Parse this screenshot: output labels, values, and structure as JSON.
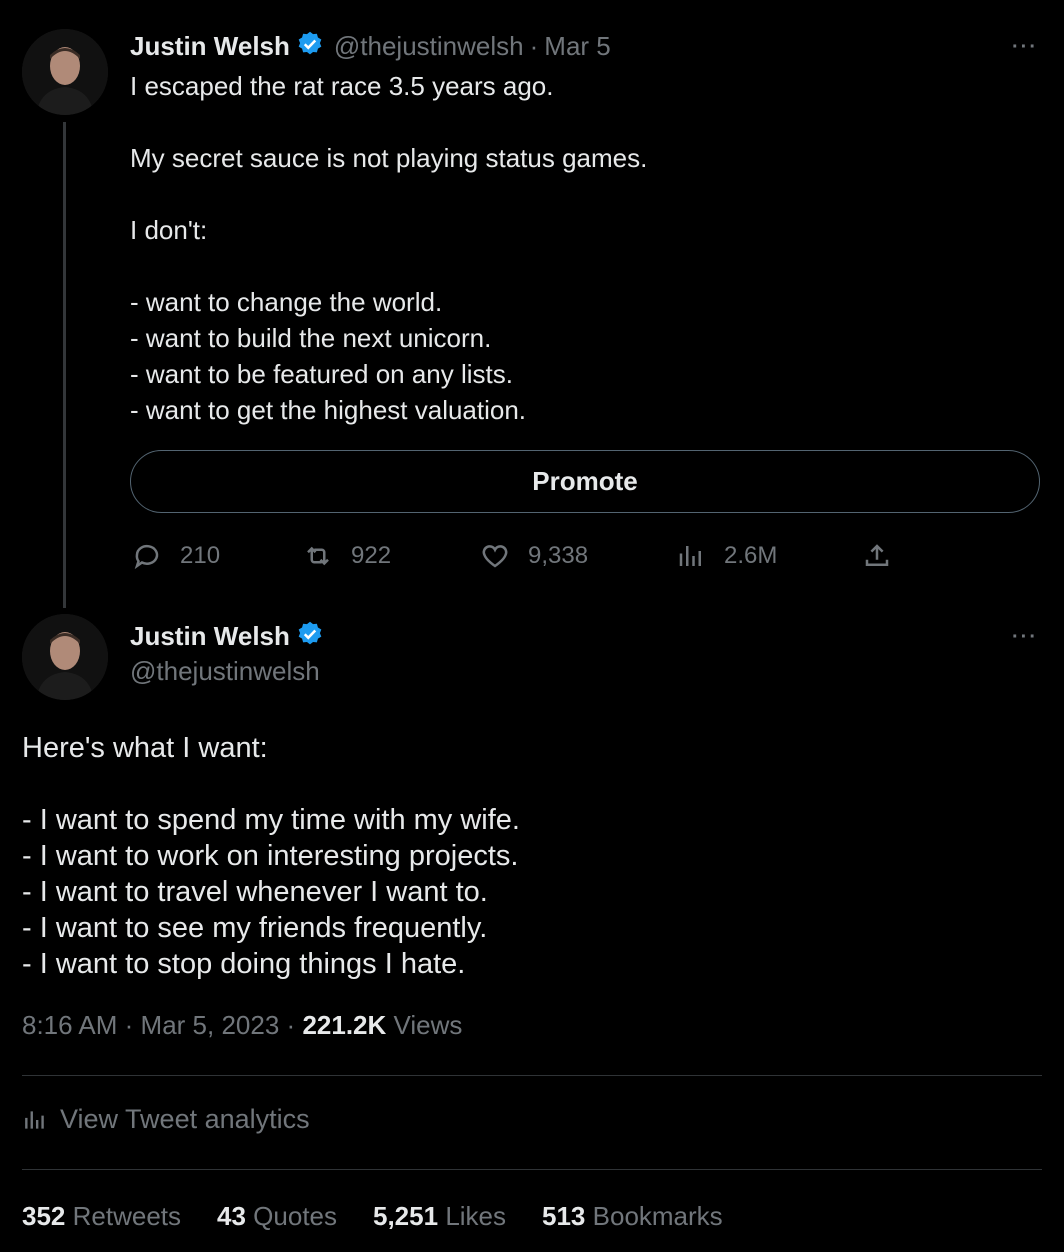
{
  "tweet1": {
    "author_name": "Justin Welsh",
    "handle": "@thejustinwelsh",
    "separator": "·",
    "date": "Mar 5",
    "more": "···",
    "text": "I escaped the rat race 3.5 years ago.\n\nMy secret sauce is not playing status games.\n\nI don't:\n\n- want to change the world.\n- want to build the next unicorn.\n- want to be featured on any lists.\n- want to get the highest valuation.",
    "promote_label": "Promote",
    "replies": "210",
    "retweets": "922",
    "likes": "9,338",
    "views": "2.6M"
  },
  "tweet2": {
    "author_name": "Justin Welsh",
    "handle": "@thejustinwelsh",
    "more": "···",
    "text": "Here's what I want:\n\n- I want to spend my time with my wife.\n- I want to work on interesting projects.\n- I want to travel whenever I want to.\n- I want to see my friends frequently.\n- I want to stop doing things I hate.",
    "time": "8:16 AM",
    "separator": "·",
    "date": "Mar 5, 2023",
    "view_count": "221.2K",
    "views_label": "Views",
    "analytics_label": "View Tweet analytics",
    "stats": {
      "retweets_count": "352",
      "retweets_label": "Retweets",
      "quotes_count": "43",
      "quotes_label": "Quotes",
      "likes_count": "5,251",
      "likes_label": "Likes",
      "bookmarks_count": "513",
      "bookmarks_label": "Bookmarks"
    }
  },
  "icons": {
    "verified": "verified-badge-icon",
    "reply": "reply-icon",
    "retweet": "retweet-icon",
    "like": "heart-icon",
    "views": "bar-chart-icon",
    "share": "share-icon"
  },
  "colors": {
    "background": "#000000",
    "text": "#e7e9ea",
    "muted": "#71767b",
    "verified": "#1d9bf0",
    "divider": "#2f3336"
  }
}
